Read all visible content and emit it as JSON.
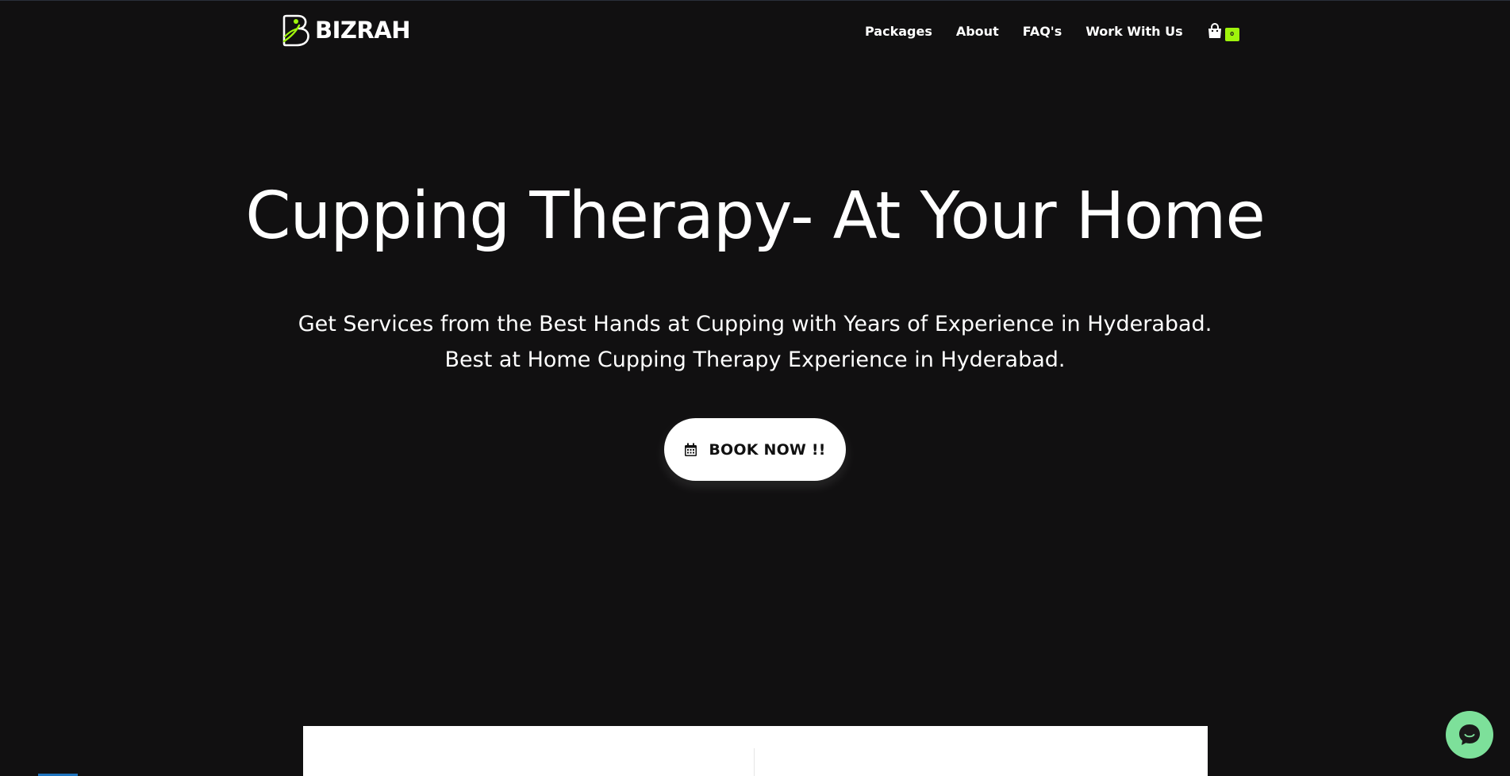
{
  "brand": {
    "name": "BIZRAH",
    "accent_color": "#9ff40c"
  },
  "nav": {
    "items": [
      {
        "label": "Packages"
      },
      {
        "label": "About"
      },
      {
        "label": "FAQ's"
      },
      {
        "label": "Work With Us"
      }
    ],
    "cart": {
      "icon": "shopping-bag-icon",
      "count": "0"
    }
  },
  "hero": {
    "title": "Cupping Therapy- At Your Home",
    "subtitle_line1": "Get Services from the Best Hands at Cupping with Years of Experience in Hyderabad.",
    "subtitle_line2": "Best at Home Cupping Therapy Experience in Hyderabad.",
    "cta": {
      "label": "BOOK NOW !!",
      "icon": "calendar-icon"
    }
  },
  "chat": {
    "icon": "chat-bubble-icon",
    "color": "#7de09a"
  }
}
